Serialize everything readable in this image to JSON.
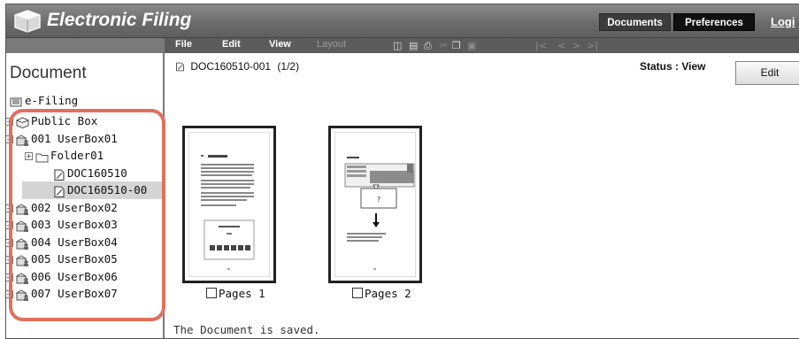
{
  "app": {
    "title": "Electronic Filing",
    "top_nav": {
      "documents": "Documents",
      "preferences": "Preferences",
      "login": "Logi"
    }
  },
  "menubar": {
    "menus": [
      "File",
      "Edit",
      "View",
      "Layout"
    ],
    "toolbar_icons": [
      "rotate-icon",
      "save-icon",
      "print-icon",
      "cut-icon",
      "copy-icon",
      "paste-icon",
      "first-page-icon",
      "prev-page-icon",
      "next-page-icon",
      "last-page-icon"
    ]
  },
  "sidebar": {
    "heading": "Document",
    "root_label": "e-Filing",
    "tree": [
      {
        "label": "Public Box",
        "expander": "+",
        "icon": "box-icon"
      },
      {
        "label": "001 UserBox01",
        "expander": "-",
        "icon": "userbox-icon"
      },
      {
        "label": "Folder01",
        "expander": "+",
        "icon": "folder-icon"
      },
      {
        "label": "DOC160510",
        "expander": "",
        "icon": "document-icon"
      },
      {
        "label": "DOC160510-00",
        "expander": "",
        "icon": "document-icon",
        "selected": true
      },
      {
        "label": "002 UserBox02",
        "expander": "+",
        "icon": "userbox-icon"
      },
      {
        "label": "003 UserBox03",
        "expander": "+",
        "icon": "userbox-icon"
      },
      {
        "label": "004 UserBox04",
        "expander": "+",
        "icon": "userbox-icon"
      },
      {
        "label": "005 UserBox05",
        "expander": "+",
        "icon": "userbox-icon"
      },
      {
        "label": "006 UserBox06",
        "expander": "+",
        "icon": "userbox-icon"
      },
      {
        "label": "007 UserBox07",
        "expander": "+",
        "icon": "userbox-icon"
      }
    ],
    "highlight_color": "#e0705c"
  },
  "content": {
    "document_title": "DOC160510-001",
    "page_indicator": "(1/2)",
    "status": "Status : View",
    "edit_button": "Edit",
    "pages": [
      {
        "label": "Pages 1",
        "checked": false
      },
      {
        "label": "Pages 2",
        "checked": false
      }
    ],
    "popup_mark": "?",
    "message": "The Document is saved."
  }
}
